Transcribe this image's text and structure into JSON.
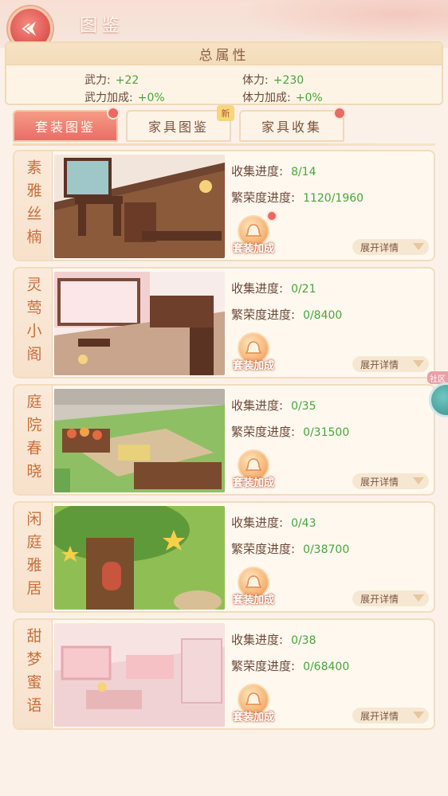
{
  "header": {
    "title": "图鉴",
    "back_icon": "back-arrow-icon"
  },
  "totals": {
    "title": "总属性",
    "stats": [
      {
        "label": "武力:",
        "value": "+22"
      },
      {
        "label": "体力:",
        "value": "+230"
      },
      {
        "label": "武力加成:",
        "value": "+0%"
      },
      {
        "label": "体力加成:",
        "value": "+0%"
      }
    ]
  },
  "tabs": [
    {
      "label": "套装图鉴",
      "active": true,
      "badge": "heart"
    },
    {
      "label": "家具图鉴",
      "active": false,
      "badge": "新"
    },
    {
      "label": "家具收集",
      "active": false,
      "badge": "heart"
    }
  ],
  "sets": [
    {
      "name": "素雅丝楠",
      "collect_label": "收集进度:",
      "collect": "8/14",
      "prosper_label": "繁荣度进度:",
      "prosper": "1120/1960",
      "bonus_label": "套装加成",
      "expand_label": "展开详情",
      "has_heart": true
    },
    {
      "name": "灵莺小阁",
      "collect_label": "收集进度:",
      "collect": "0/21",
      "prosper_label": "繁荣度进度:",
      "prosper": "0/8400",
      "bonus_label": "套装加成",
      "expand_label": "展开详情",
      "has_heart": false
    },
    {
      "name": "庭院春晓",
      "collect_label": "收集进度:",
      "collect": "0/35",
      "prosper_label": "繁荣度进度:",
      "prosper": "0/31500",
      "bonus_label": "套装加成",
      "expand_label": "展开详情",
      "has_heart": false
    },
    {
      "name": "闲庭雅居",
      "collect_label": "收集进度:",
      "collect": "0/43",
      "prosper_label": "繁荣度进度:",
      "prosper": "0/38700",
      "bonus_label": "套装加成",
      "expand_label": "展开详情",
      "has_heart": false
    },
    {
      "name": "甜梦蜜语",
      "collect_label": "收集进度:",
      "collect": "0/38",
      "prosper_label": "繁荣度进度:",
      "prosper": "0/68400",
      "bonus_label": "套装加成",
      "expand_label": "展开详情",
      "has_heart": false
    }
  ],
  "community": {
    "label": "社区"
  },
  "colors": {
    "accent": "#ea6e66",
    "value_green": "#4aa53a",
    "panel": "#fff8ef"
  }
}
